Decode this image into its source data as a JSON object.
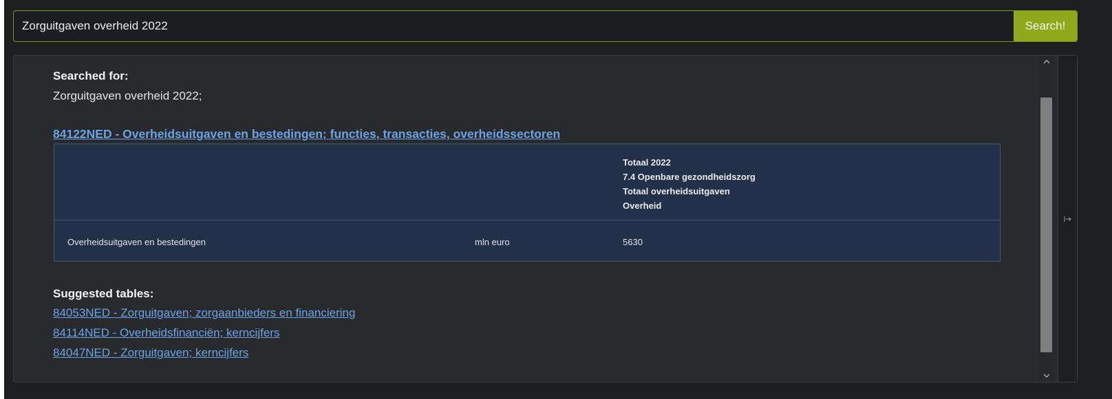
{
  "search": {
    "value": "Zorguitgaven overheid 2022",
    "button_label": "Search!"
  },
  "results": {
    "searched_for_label": "Searched for:",
    "searched_for_query": "Zorguitgaven overheid 2022;",
    "main_table_link": "84122NED - Overheidsuitgaven en bestedingen; functies, transacties, overheidssectoren",
    "table": {
      "header_lines": [
        "Totaal 2022",
        "7.4 Openbare gezondheidszorg",
        "Totaal overheidsuitgaven",
        "Overheid"
      ],
      "row": {
        "label": "Overheidsuitgaven en bestedingen",
        "unit": "mln euro",
        "value": "5630"
      }
    },
    "suggested_label": "Suggested tables:",
    "suggested_tables": [
      "84053NED - Zorguitgaven; zorgaanbieders en financiering",
      "84114NED - Overheidsfinanciën; kerncijfers",
      "84047NED - Zorguitgaven; kerncijfers"
    ]
  },
  "colors": {
    "accent": "#8fa91b",
    "link": "#6ba2e6",
    "table_bg": "#233049",
    "panel_bg": "#282a2d",
    "page_bg": "#1d1f21"
  },
  "icons": {
    "scroll_up": "chevron-up-icon",
    "scroll_down": "chevron-down-icon",
    "collapse": "arrow-right-to-bar-icon"
  }
}
